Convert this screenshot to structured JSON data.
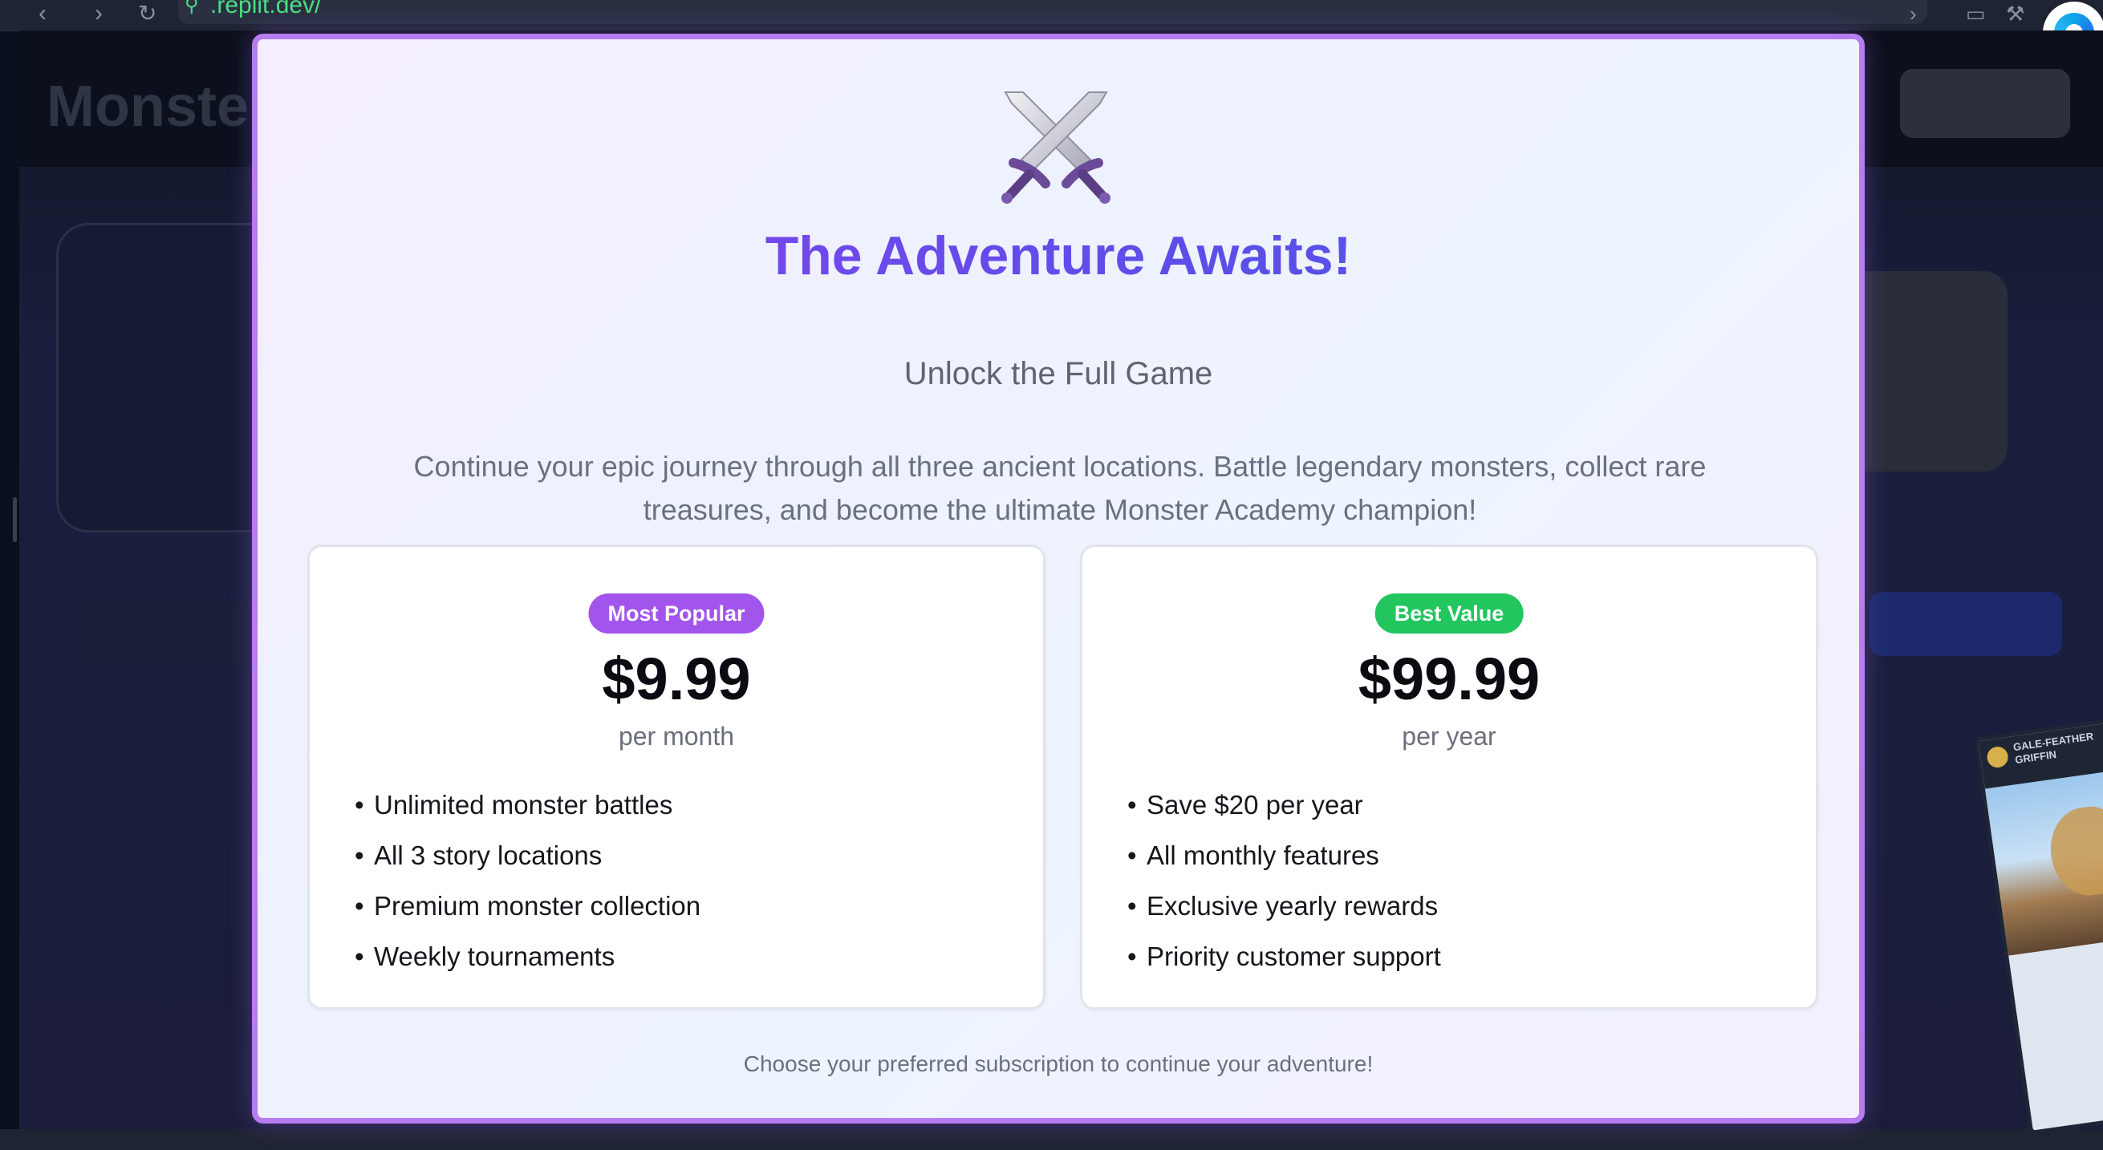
{
  "browser": {
    "url_display": ".replit.dev/",
    "back_icon": "chevron-left-icon",
    "forward_icon": "chevron-right-icon",
    "reload_icon": "reload-icon"
  },
  "app": {
    "logo_text": "Monster"
  },
  "modal": {
    "title": "The Adventure Awaits!",
    "subtitle": "Unlock the Full Game",
    "description": "Continue your epic journey through all three ancient locations. Battle legendary monsters, collect rare treasures, and become the ultimate Monster Academy champion!",
    "footer": "Choose your preferred subscription to continue your adventure!",
    "colors": {
      "border": "#b77cf0",
      "title_gradient_start": "#8b3ff0",
      "title_gradient_end": "#4f5ce6"
    },
    "plans": [
      {
        "badge": "Most Popular",
        "badge_color": "#a255ec",
        "price": "$9.99",
        "period": "per month",
        "features": [
          "Unlimited monster battles",
          "All 3 story locations",
          "Premium monster collection",
          "Weekly tournaments"
        ]
      },
      {
        "badge": "Best Value",
        "badge_color": "#22c55e",
        "price": "$99.99",
        "period": "per year",
        "features": [
          "Save $20 per year",
          "All monthly features",
          "Exclusive yearly rewards",
          "Priority customer support"
        ]
      }
    ]
  },
  "monster_card": {
    "name": "GALE-FEATHER GRIFFIN"
  }
}
